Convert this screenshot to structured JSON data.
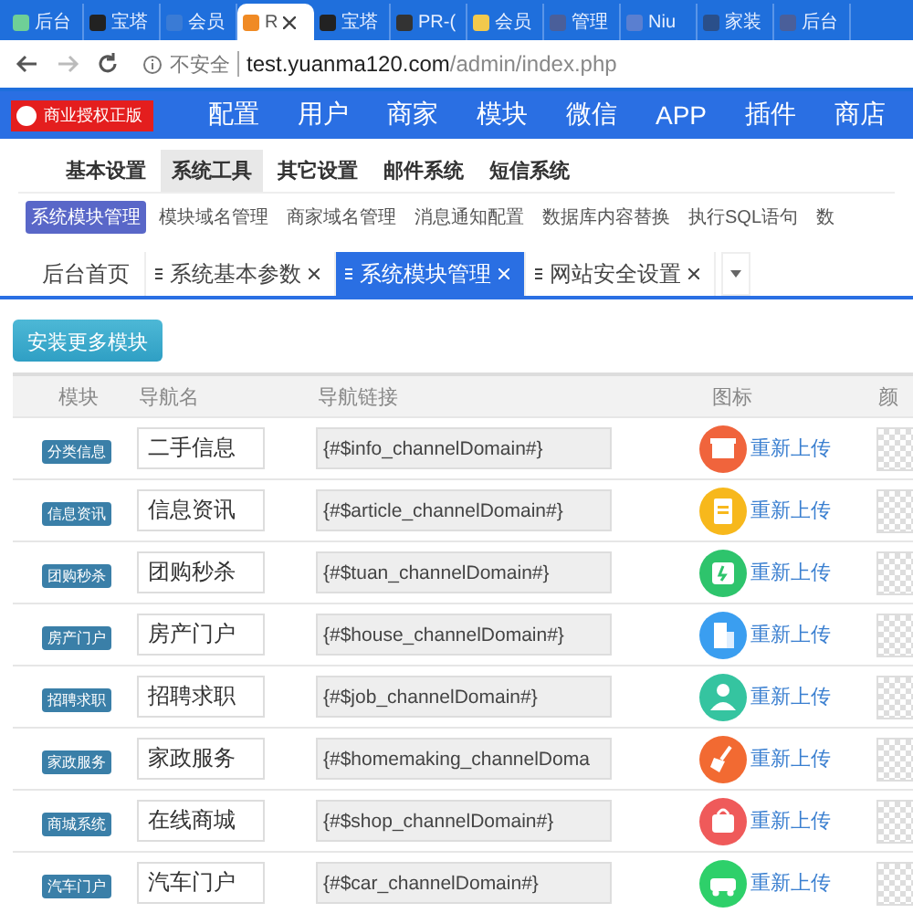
{
  "browser_tabs": [
    {
      "title": "后台",
      "selected": false,
      "color": "#6fcf97"
    },
    {
      "title": "宝塔",
      "selected": false,
      "color": "#222222"
    },
    {
      "title": "会员",
      "selected": false,
      "color": "#3a7bd5"
    },
    {
      "title": "R",
      "selected": true,
      "color": "#f08a24"
    },
    {
      "title": "宝塔",
      "selected": false,
      "color": "#222222"
    },
    {
      "title": "PR-(",
      "selected": false,
      "color": "#333333"
    },
    {
      "title": "会员",
      "selected": false,
      "color": "#f2c94c"
    },
    {
      "title": "管理",
      "selected": false,
      "color": "#4a5f9a"
    },
    {
      "title": "Niu",
      "selected": false,
      "color": "#5a7fd0"
    },
    {
      "title": "家装",
      "selected": false,
      "color": "#2a4f8a"
    },
    {
      "title": "后台",
      "selected": false,
      "color": "#4a5f9a"
    }
  ],
  "address_bar": {
    "security": "不安全",
    "host": "test.yuanma120.com",
    "path": "/admin/index.php"
  },
  "header": {
    "badge": "商业授权正版",
    "nav": [
      "配置",
      "用户",
      "商家",
      "模块",
      "微信",
      "APP",
      "插件",
      "商店"
    ]
  },
  "sub_nav": [
    {
      "label": "基本设置",
      "selected": false
    },
    {
      "label": "系统工具",
      "selected": true
    },
    {
      "label": "其它设置",
      "selected": false
    },
    {
      "label": "邮件系统",
      "selected": false
    },
    {
      "label": "短信系统",
      "selected": false
    }
  ],
  "tool_nav": [
    {
      "label": "系统模块管理",
      "selected": true
    },
    {
      "label": "模块域名管理",
      "selected": false
    },
    {
      "label": "商家域名管理",
      "selected": false
    },
    {
      "label": "消息通知配置",
      "selected": false
    },
    {
      "label": "数据库内容替换",
      "selected": false
    },
    {
      "label": "执行SQL语句",
      "selected": false
    },
    {
      "label": "数",
      "selected": false
    }
  ],
  "page_tabs": [
    {
      "label": "后台首页",
      "selected": false,
      "closable": false
    },
    {
      "label": "系统基本参数",
      "selected": false,
      "closable": true
    },
    {
      "label": "系统模块管理",
      "selected": true,
      "closable": true
    },
    {
      "label": "网站安全设置",
      "selected": false,
      "closable": true
    }
  ],
  "install_button": "安装更多模块",
  "table": {
    "columns": [
      "模块",
      "导航名",
      "导航链接",
      "图标",
      "颜"
    ],
    "rows": [
      {
        "module": "分类信息",
        "name": "二手信息",
        "link": "{#$info_channelDomain#}",
        "kind": "box",
        "color": "#f0643c",
        "action": "重新上传"
      },
      {
        "module": "信息资讯",
        "name": "信息资讯",
        "link": "{#$article_channelDomain#}",
        "kind": "note",
        "color": "#f7b81c",
        "action": "重新上传"
      },
      {
        "module": "团购秒杀",
        "name": "团购秒杀",
        "link": "{#$tuan_channelDomain#}",
        "kind": "ticket",
        "color": "#2ec46c",
        "action": "重新上传"
      },
      {
        "module": "房产门户",
        "name": "房产门户",
        "link": "{#$house_channelDomain#}",
        "kind": "building",
        "color": "#3a9ef0",
        "action": "重新上传"
      },
      {
        "module": "招聘求职",
        "name": "招聘求职",
        "link": "{#$job_channelDomain#}",
        "kind": "person",
        "color": "#35c4a0",
        "action": "重新上传"
      },
      {
        "module": "家政服务",
        "name": "家政服务",
        "link": "{#$homemaking_channelDoma",
        "kind": "broom",
        "color": "#f26a32",
        "action": "重新上传"
      },
      {
        "module": "商城系统",
        "name": "在线商城",
        "link": "{#$shop_channelDomain#}",
        "kind": "bag",
        "color": "#ef5a5a",
        "action": "重新上传"
      },
      {
        "module": "汽车门户",
        "name": "汽车门户",
        "link": "{#$car_channelDomain#}",
        "kind": "car",
        "color": "#2ed06a",
        "action": "重新上传"
      }
    ]
  }
}
